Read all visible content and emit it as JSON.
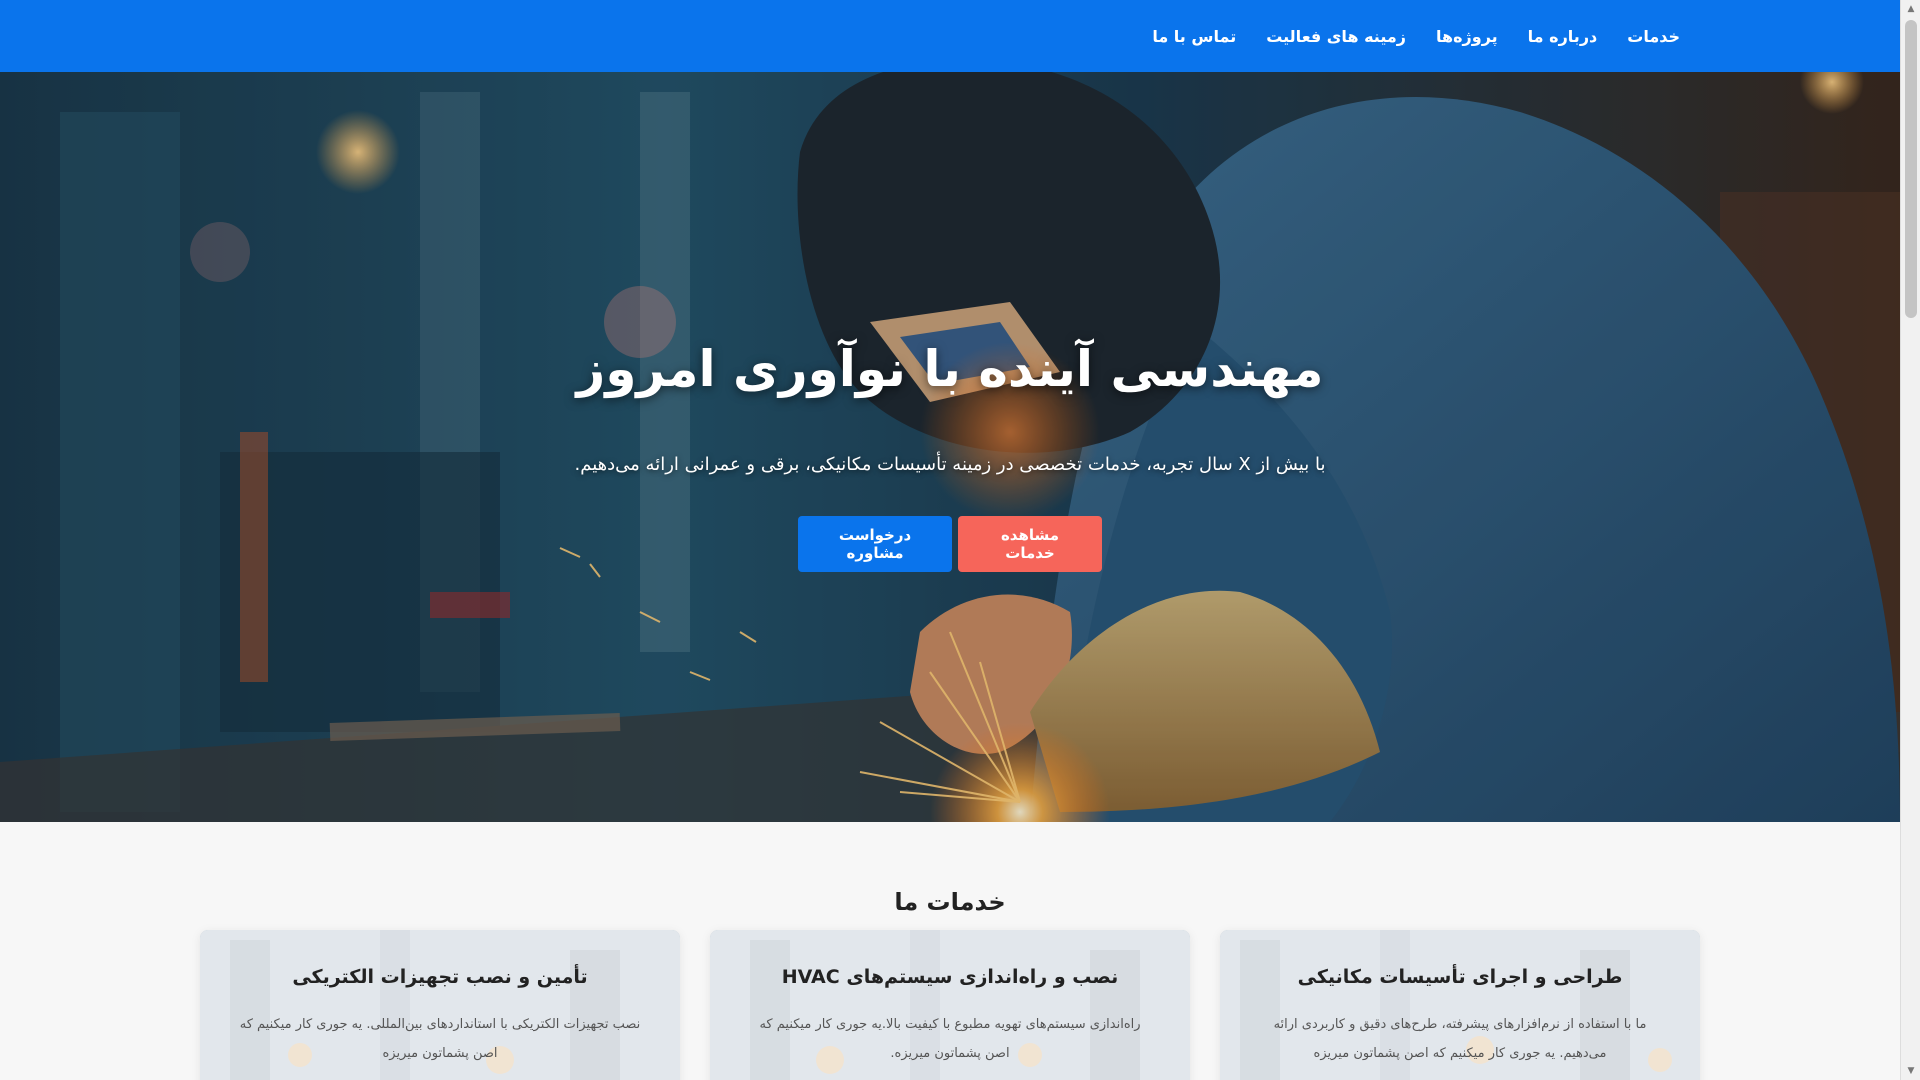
{
  "nav": {
    "items": [
      {
        "label": "خدمات"
      },
      {
        "label": "درباره ما"
      },
      {
        "label": "پروژه‌ها"
      },
      {
        "label": "زمینه های فعالیت"
      },
      {
        "label": "تماس با ما"
      }
    ]
  },
  "hero": {
    "title": "مهندسی آینده با نوآوری امروز",
    "subtitle": "با بیش از X سال تجربه، خدمات تخصصی در زمینه تأسیسات مکانیکی، برقی و عمرانی ارائه می‌دهیم.",
    "buttons": {
      "services_label": "مشاهده خدمات",
      "consult_label": "درخواست مشاوره"
    },
    "image_icon": "welder-photo"
  },
  "services": {
    "title": "خدمات ما",
    "cards": [
      {
        "title": "طراحی و اجرای تأسیسات مکانیکی",
        "text": "ما با استفاده از نرم‌افزارهای پیشرفته، طرح‌های دقیق و کاربردی ارائه می‌دهیم. یه جوری کار میکنیم که اصن پشماتون میریزه"
      },
      {
        "title": "نصب و راه‌اندازی سیستم‌های HVAC",
        "text": "راه‌اندازی سیستم‌های تهویه مطبوع با کیفیت بالا.یه جوری کار میکنیم که اصن پشماتون میریزه."
      },
      {
        "title": "تأمین و نصب تجهیزات الکتریکی",
        "text": "نصب تجهیزات الکتریکی با استانداردهای بین‌المللی. یه جوری کار میکنیم که اصن پشماتون میریزه"
      }
    ]
  },
  "colors": {
    "primary": "#0a74ec",
    "accent": "#f6655a",
    "background": "#f7f7f7"
  }
}
